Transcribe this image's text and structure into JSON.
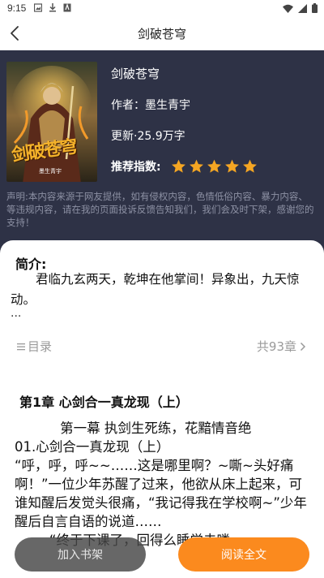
{
  "status_bar": {
    "time": "9:15"
  },
  "nav": {
    "title": "剑破苍穹"
  },
  "book": {
    "name": "剑破苍穹",
    "author_label": "作者：",
    "author": "墨生青宇",
    "update_label": "更新·",
    "update_words": "25.9万字",
    "rating_label": "推荐指数:",
    "rating_stars": 5,
    "star_color": "#f5a623",
    "cover_title": "剑破苍穹",
    "cover_author": "墨生青宇"
  },
  "disclaimer": "声明:本内容来源于网友提供，如有侵权内容，色情低俗内容、暴力内容、等违规内容，请在我的页面投诉反馈告知我们，我们会及时下架，感谢您的支持！",
  "intro": {
    "label": "简介:",
    "text": "君临九玄两天，乾坤在他掌间！异象出，九天惊动。",
    "more": "..."
  },
  "toc": {
    "label": "目录",
    "count": "共93章"
  },
  "chapter": {
    "title": "第1章 心剑合一真龙现（上）",
    "paragraphs": [
      "第一幕   执剑生死练，花黯情音绝",
      "01.心剑合一真龙现（上）",
      "“呼，呼，呼~~……这是哪里啊？~嘶~头好痛啊！”一位少年苏醒了过来，他欲从床上起来，可谁知醒后发觉头很痛，“我记得我在学校啊~”少年醒后自言自语的说道……",
      "“终于下课了，回得么睡觉去喽"
    ]
  },
  "buttons": {
    "add_shelf": "加入书架",
    "read_all": "阅读全文"
  },
  "colors": {
    "hero_bg": "#2e3246",
    "accent": "#fb8a1e"
  }
}
